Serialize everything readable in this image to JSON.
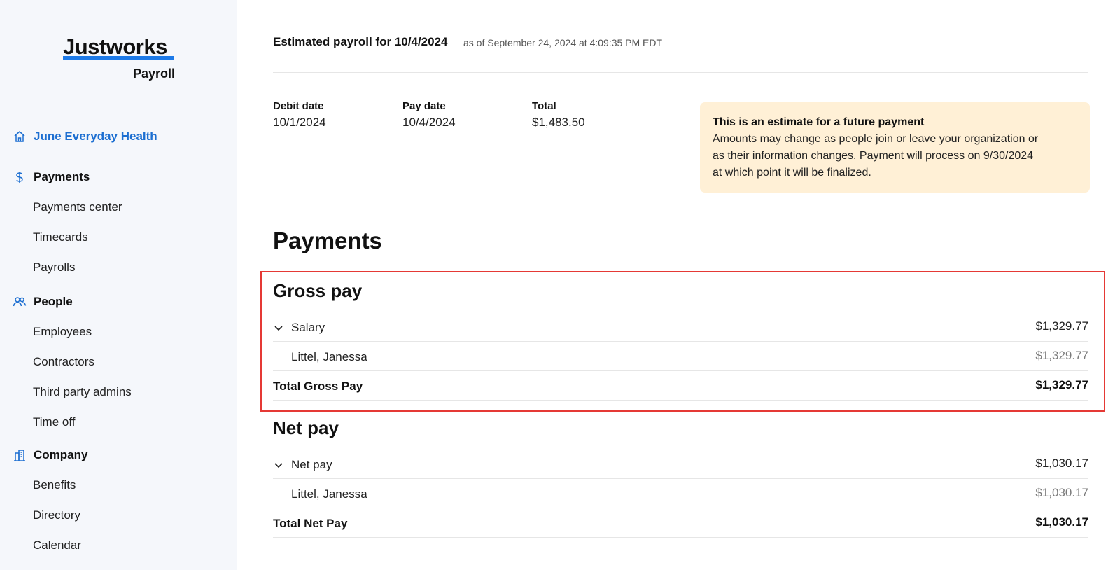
{
  "brand": {
    "name": "Justworks",
    "product": "Payroll",
    "accent": "#1d7ae8"
  },
  "sidebar": {
    "org": {
      "label": "June Everyday Health",
      "icon": "home-icon"
    },
    "sections": [
      {
        "label": "Payments",
        "icon": "dollar-icon",
        "items": [
          "Payments center",
          "Timecards",
          "Payrolls"
        ]
      },
      {
        "label": "People",
        "icon": "people-icon",
        "items": [
          "Employees",
          "Contractors",
          "Third party admins",
          "Time off"
        ]
      },
      {
        "label": "Company",
        "icon": "building-icon",
        "items": [
          "Benefits",
          "Directory",
          "Calendar"
        ]
      }
    ]
  },
  "header": {
    "title": "Estimated payroll for 10/4/2024",
    "as_of": "as of September 24, 2024 at 4:09:35 PM EDT"
  },
  "summary": {
    "debit_date_label": "Debit date",
    "debit_date": "10/1/2024",
    "pay_date_label": "Pay date",
    "pay_date": "10/4/2024",
    "total_label": "Total",
    "total": "$1,483.50"
  },
  "notice": {
    "title": "This is an estimate for a future payment",
    "lines": [
      "Amounts may change as people join or leave your organization or",
      "as their information changes. Payment will process on 9/30/2024",
      "at which point it will be finalized."
    ],
    "bg_color": "#fff0d6"
  },
  "payments": {
    "heading": "Payments",
    "gross": {
      "heading": "Gross pay",
      "group_label": "Salary",
      "group_amount": "$1,329.77",
      "person": "Littel, Janessa",
      "person_amount": "$1,329.77",
      "total_label": "Total Gross Pay",
      "total_amount": "$1,329.77"
    },
    "net": {
      "heading": "Net pay",
      "group_label": "Net pay",
      "group_amount": "$1,030.17",
      "person": "Littel, Janessa",
      "person_amount": "$1,030.17",
      "total_label": "Total Net Pay",
      "total_amount": "$1,030.17"
    }
  }
}
